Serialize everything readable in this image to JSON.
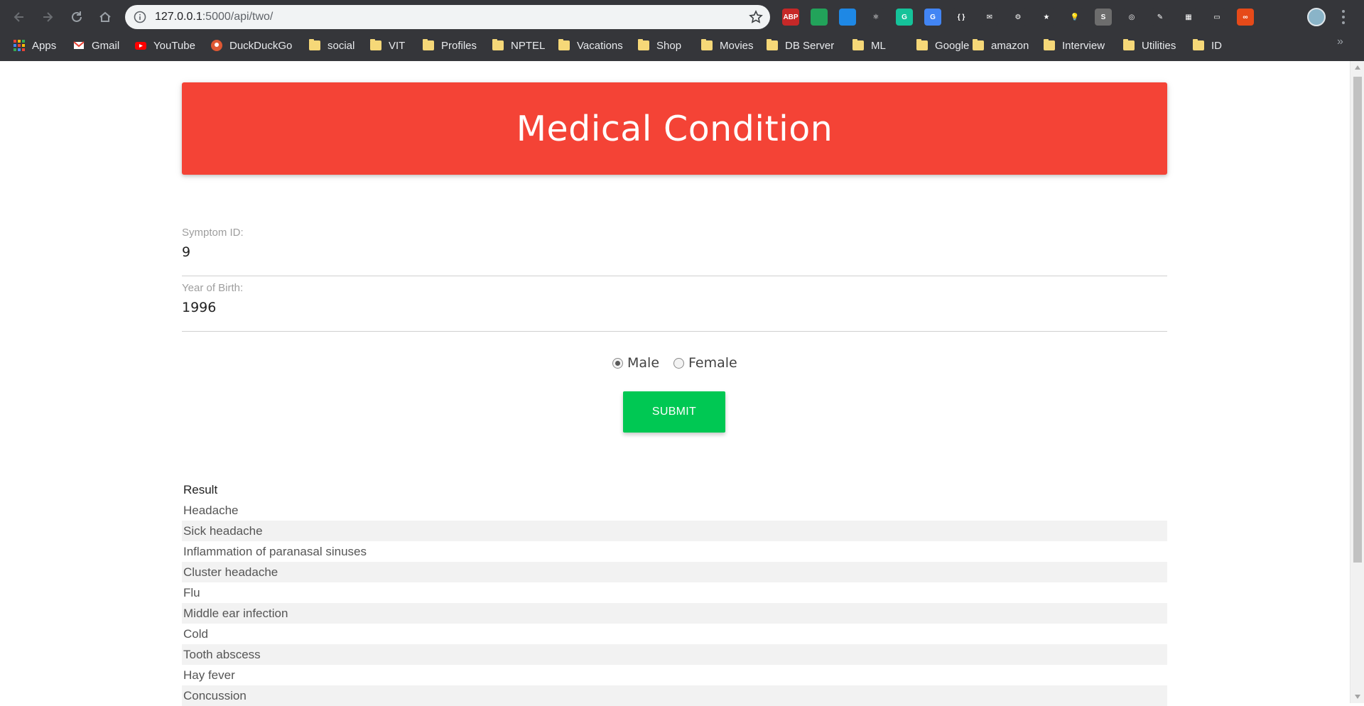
{
  "browser": {
    "url_host": "127.0.0.1",
    "url_rest": ":5000/api/two/",
    "extensions": [
      {
        "name": "adblock-plus-icon",
        "label": "ABP",
        "color": "#c62828"
      },
      {
        "name": "green-extension-icon",
        "label": "",
        "color": "#22a35a"
      },
      {
        "name": "blue-extension-icon",
        "label": "",
        "color": "#1e88e5"
      },
      {
        "name": "react-devtools-icon",
        "label": "⚛",
        "color": "#35363a"
      },
      {
        "name": "grammarly-icon",
        "label": "G",
        "color": "#15c39a"
      },
      {
        "name": "google-translate-icon",
        "label": "G",
        "color": "#4285f4"
      },
      {
        "name": "json-formatter-icon",
        "label": "{ }",
        "color": "#35363a"
      },
      {
        "name": "mail-extension-icon",
        "label": "✉",
        "color": "#35363a"
      },
      {
        "name": "settings-extension-icon",
        "label": "⚙",
        "color": "#35363a"
      },
      {
        "name": "star-extension-icon",
        "label": "★",
        "color": "#35363a"
      },
      {
        "name": "lightbulb-extension-icon",
        "label": "💡",
        "color": "#35363a"
      },
      {
        "name": "s-extension-icon",
        "label": "S",
        "color": "#6d6d6d"
      },
      {
        "name": "swirl-extension-icon",
        "label": "◎",
        "color": "#35363a"
      },
      {
        "name": "pen-extension-icon",
        "label": "✎",
        "color": "#35363a"
      },
      {
        "name": "chart-extension-icon",
        "label": "▦",
        "color": "#35363a"
      },
      {
        "name": "window-extension-icon",
        "label": "▭",
        "color": "#35363a"
      },
      {
        "name": "infinity-extension-icon",
        "label": "∞",
        "color": "#e64a19"
      },
      {
        "name": "octocat-extension-icon",
        "label": "",
        "color": "#35363a"
      }
    ],
    "bookmarks": [
      {
        "name": "bookmark-apps",
        "label": "Apps",
        "icon": "apps-grid-icon"
      },
      {
        "name": "bookmark-gmail",
        "label": "Gmail",
        "icon": "gmail-icon"
      },
      {
        "name": "bookmark-youtube",
        "label": "YouTube",
        "icon": "youtube-icon"
      },
      {
        "name": "bookmark-duckduckgo",
        "label": "DuckDuckGo",
        "icon": "duckduckgo-icon"
      },
      {
        "name": "bookmark-social",
        "label": "social",
        "icon": "folder-icon"
      },
      {
        "name": "bookmark-vit",
        "label": "VIT",
        "icon": "folder-icon"
      },
      {
        "name": "bookmark-profiles",
        "label": "Profiles",
        "icon": "folder-icon"
      },
      {
        "name": "bookmark-nptel",
        "label": "NPTEL",
        "icon": "folder-icon"
      },
      {
        "name": "bookmark-vacations",
        "label": "Vacations",
        "icon": "folder-icon"
      },
      {
        "name": "bookmark-shop",
        "label": "Shop",
        "icon": "folder-icon"
      },
      {
        "name": "bookmark-movies",
        "label": "Movies",
        "icon": "folder-icon"
      },
      {
        "name": "bookmark-db-server",
        "label": "DB Server",
        "icon": "folder-icon"
      },
      {
        "name": "bookmark-ml",
        "label": "ML",
        "icon": "folder-icon"
      },
      {
        "name": "bookmark-google",
        "label": "Google",
        "icon": "folder-icon"
      },
      {
        "name": "bookmark-amazon",
        "label": "amazon",
        "icon": "folder-icon"
      },
      {
        "name": "bookmark-interview",
        "label": "Interview",
        "icon": "folder-icon"
      },
      {
        "name": "bookmark-utilities",
        "label": "Utilities",
        "icon": "folder-icon"
      },
      {
        "name": "bookmark-id",
        "label": "ID",
        "icon": "folder-icon"
      }
    ],
    "bookmarks_overflow": "»"
  },
  "page": {
    "title": "Medical Condition",
    "header_color": "#f44336",
    "form": {
      "symptom_label": "Symptom ID:",
      "symptom_value": "9",
      "yob_label": "Year of Birth:",
      "yob_value": "1996",
      "gender_male": "Male",
      "gender_female": "Female",
      "gender_selected": "Male",
      "submit_label": "SUBMIT",
      "submit_color": "#00c853"
    },
    "results": {
      "header": "Result",
      "items": [
        "Headache",
        "Sick headache",
        "Inflammation of paranasal sinuses",
        "Cluster headache",
        "Flu",
        "Middle ear infection",
        "Cold",
        "Tooth abscess",
        "Hay fever",
        "Concussion"
      ]
    }
  }
}
